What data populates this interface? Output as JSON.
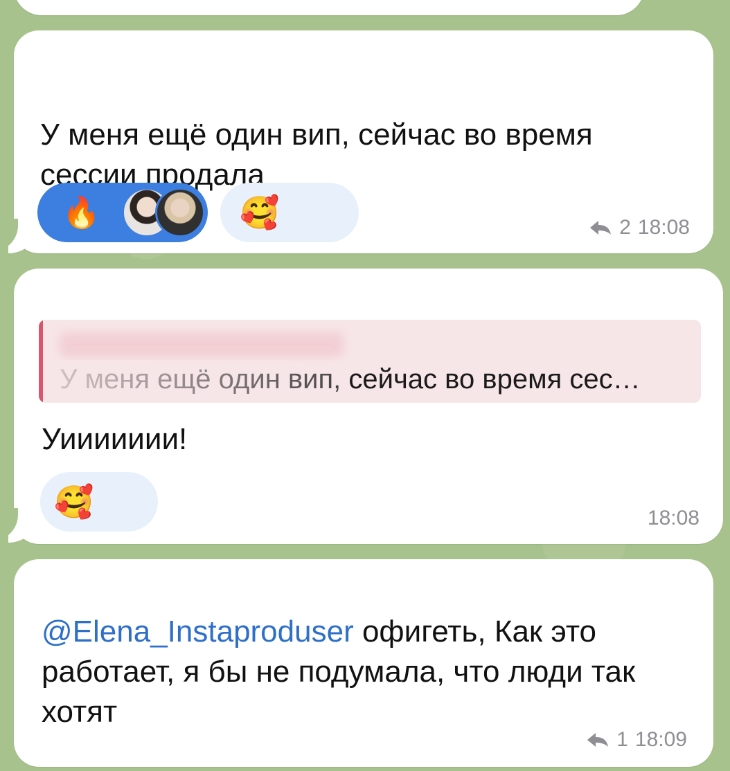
{
  "messages": [
    {
      "text": "У меня ещё один вип, сейчас во время сессии продала",
      "reactions": [
        {
          "emoji": "🔥",
          "avatars": 2,
          "active": true
        },
        {
          "emoji": "🥰",
          "active": false
        }
      ],
      "reply_count": "2",
      "time": "18:08"
    },
    {
      "quote_text": "У меня ещё один вип, сейчас во время сес…",
      "text": "Уиииииии!",
      "reactions": [
        {
          "emoji": "🥰",
          "active": false
        }
      ],
      "time": "18:08"
    },
    {
      "mention": "@Elena_Instaproduser",
      "text": " офигеть, Как это работает, я бы не подумала, что люди так хотят",
      "reply_count": "1",
      "time": "18:09"
    }
  ],
  "colors": {
    "background": "#a7c28c",
    "bubble": "#ffffff",
    "active_reaction": "#3d7fe0",
    "passive_reaction": "#e7f0fb",
    "mention": "#2e6fc9",
    "quote_bar": "#d8566e",
    "meta": "#8e8e93"
  },
  "icons": {
    "reply": "reply-arrow-icon",
    "fire": "fire-emoji",
    "hearts_face": "smiling-face-with-hearts-emoji"
  }
}
